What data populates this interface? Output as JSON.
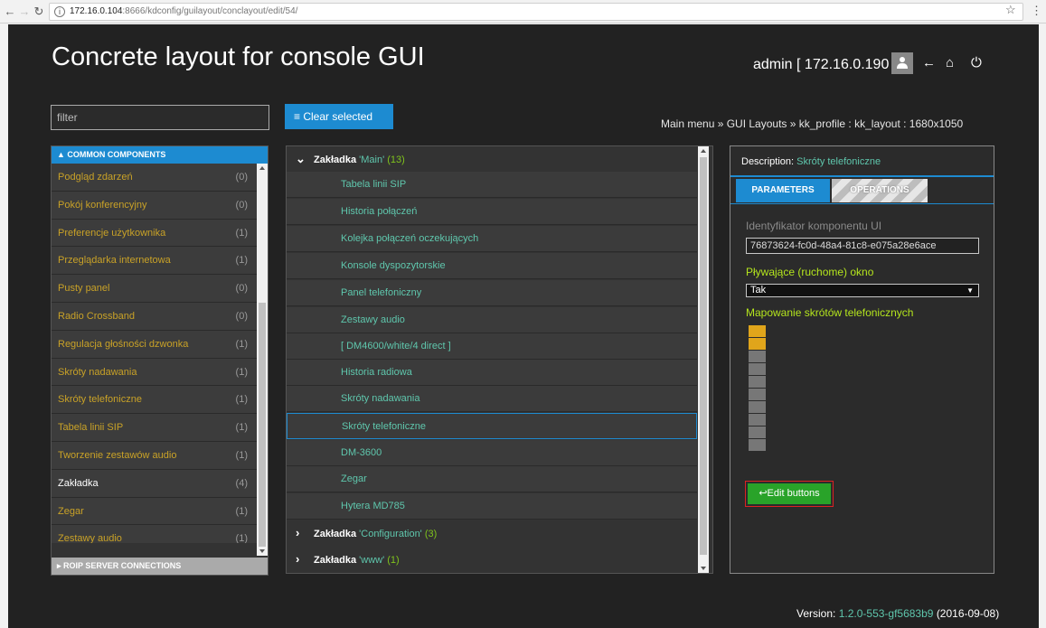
{
  "browser": {
    "url_host": "172.16.0.104",
    "url_path": ":8666/kdconfig/guilayout/conclayout/edit/54/"
  },
  "header": {
    "title": "Concrete layout for console GUI",
    "user": "admin [ 172.16.0.190 ]"
  },
  "filter": {
    "placeholder": "filter"
  },
  "clear_button": "Clear selected",
  "breadcrumb": "Main menu » GUI Layouts » kk_profile : kk_layout : 1680x1050",
  "left": {
    "header": "COMMON COMPONENTS",
    "footer": "ROIP SERVER CONNECTIONS",
    "items": [
      {
        "name": "Podgląd zdarzeń",
        "count": "(0)"
      },
      {
        "name": "Pokój konferencyjny",
        "count": "(0)"
      },
      {
        "name": "Preferencje użytkownika",
        "count": "(1)"
      },
      {
        "name": "Przeglądarka internetowa",
        "count": "(1)"
      },
      {
        "name": "Pusty panel",
        "count": "(0)"
      },
      {
        "name": "Radio Crossband",
        "count": "(0)"
      },
      {
        "name": "Regulacja głośności dzwonka",
        "count": "(1)"
      },
      {
        "name": "Skróty nadawania",
        "count": "(1)"
      },
      {
        "name": "Skróty telefoniczne",
        "count": "(1)"
      },
      {
        "name": "Tabela linii SIP",
        "count": "(1)"
      },
      {
        "name": "Tworzenie zestawów audio",
        "count": "(1)"
      },
      {
        "name": "Zakładka",
        "count": "(4)"
      },
      {
        "name": "Zegar",
        "count": "(1)"
      },
      {
        "name": "Zestawy audio",
        "count": "(1)"
      }
    ]
  },
  "middle": {
    "group_main": {
      "title": "Zakładka",
      "name": "'Main'",
      "count": "(13)"
    },
    "items": [
      "Tabela linii SIP",
      "Historia połączeń",
      "Kolejka połączeń oczekujących",
      "Konsole dyspozytorskie",
      "Panel telefoniczny",
      "Zestawy audio",
      "[ DM4600/white/4 direct ]",
      "Historia radiowa",
      "Skróty nadawania",
      "Skróty telefoniczne",
      "DM-3600",
      "Zegar",
      "Hytera MD785"
    ],
    "group_config": {
      "title": "Zakładka",
      "name": "'Configuration'",
      "count": "(3)"
    },
    "group_www": {
      "title": "Zakładka",
      "name": "'www'",
      "count": "(1)"
    }
  },
  "right": {
    "desc_label": "Description:",
    "desc_value": "Skróty telefoniczne",
    "tab_parameters": "PARAMETERS",
    "tab_operations": "OPERATIONS",
    "field1_label": "Identyfikator komponentu UI",
    "field1_value": "76873624-fc0d-48a4-81c8-e075a28e6ace",
    "field2_label": "Pływające (ruchome) okno",
    "field2_value": "Tak",
    "field3_label": "Mapowanie skrótów telefonicznych",
    "edit_button": "↩Edit buttons"
  },
  "version": {
    "label": "Version:",
    "value": "1.2.0-553-gf5683b9",
    "date": "(2016-09-08)"
  },
  "colors": {
    "accent": "#1d8bd1",
    "teal": "#5fc7ad",
    "gold": "#c9a227",
    "green_btn": "#29a329",
    "background": "#222222"
  }
}
